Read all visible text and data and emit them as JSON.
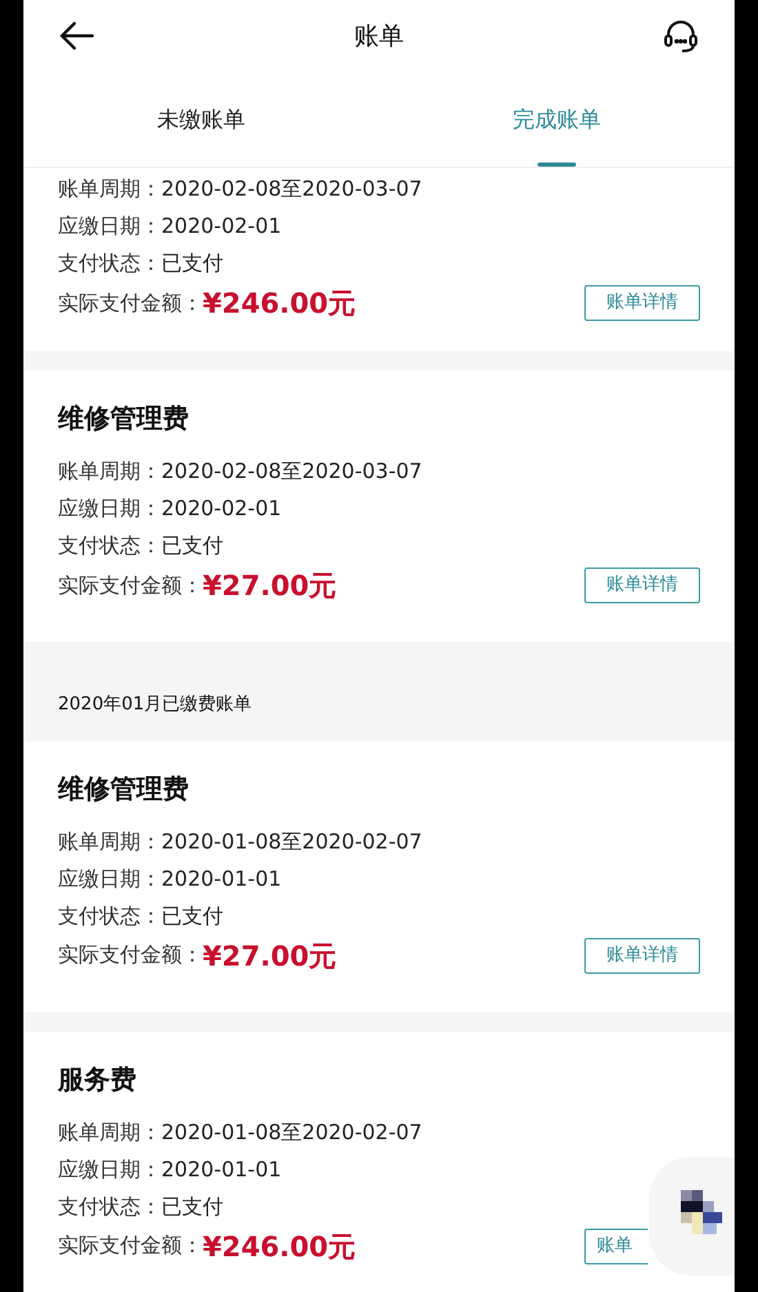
{
  "header": {
    "title": "账单"
  },
  "tabs": [
    {
      "label": "未缴账单",
      "selected": false
    },
    {
      "label": "完成账单",
      "selected": true
    }
  ],
  "sections": [
    {
      "kind": "card",
      "rows": [
        {
          "label": "账单周期：",
          "value": "2020-02-08至2020-03-07"
        },
        {
          "label": "应缴日期：",
          "value": "2020-02-01"
        },
        {
          "label": "支付状态：",
          "value": "已支付"
        }
      ],
      "amount_label": "实际支付金额：",
      "amount": "¥246.00元",
      "button": "账单详情"
    },
    {
      "kind": "card",
      "title": "维修管理费",
      "rows": [
        {
          "label": "账单周期：",
          "value": "2020-02-08至2020-03-07"
        },
        {
          "label": "应缴日期：",
          "value": "2020-02-01"
        },
        {
          "label": "支付状态：",
          "value": "已支付"
        }
      ],
      "amount_label": "实际支付金额：",
      "amount": "¥27.00元",
      "button": "账单详情"
    },
    {
      "kind": "group_header",
      "text": "2020年01月已缴费账单"
    },
    {
      "kind": "card",
      "title": "维修管理费",
      "rows": [
        {
          "label": "账单周期：",
          "value": "2020-01-08至2020-02-07"
        },
        {
          "label": "应缴日期：",
          "value": "2020-01-01"
        },
        {
          "label": "支付状态：",
          "value": "已支付"
        }
      ],
      "amount_label": "实际支付金额：",
      "amount": "¥27.00元",
      "button": "账单详情"
    },
    {
      "kind": "card",
      "title": "服务费",
      "rows": [
        {
          "label": "账单周期：",
          "value": "2020-01-08至2020-02-07"
        },
        {
          "label": "应缴日期：",
          "value": "2020-01-01"
        },
        {
          "label": "支付状态：",
          "value": "已支付"
        }
      ],
      "amount_label": "实际支付金额：",
      "amount": "¥246.00元",
      "button": "账单"
    }
  ]
}
